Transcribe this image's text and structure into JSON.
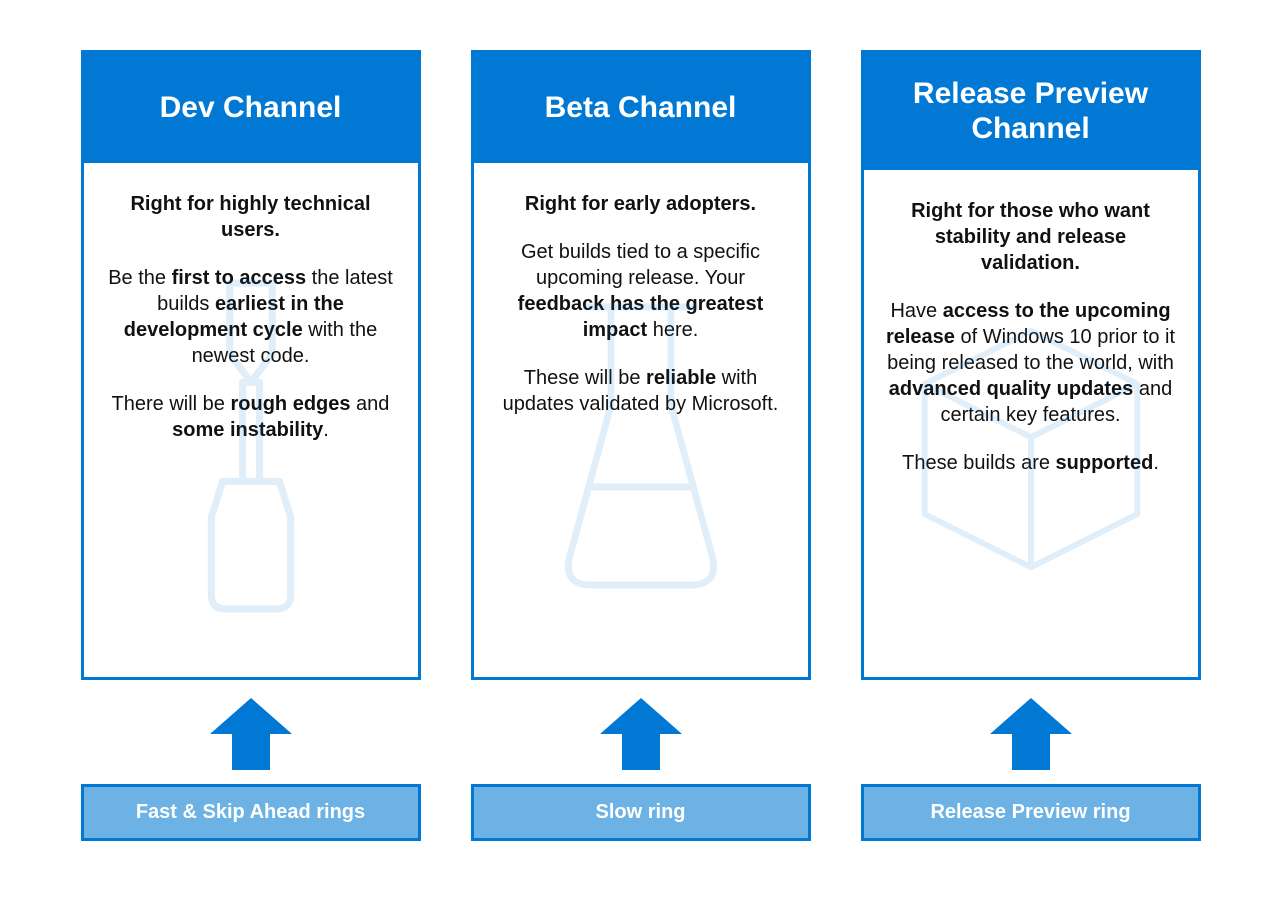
{
  "colors": {
    "brand": "#0078D4",
    "ringFill": "#6CB2E4"
  },
  "channels": [
    {
      "title": "Dev Channel",
      "lead": "Right for highly technical users.",
      "body_html": "Be the <b>first to access</b> the latest builds <b>earliest in the development cycle</b> with the newest code.",
      "tail_html": "There will be <b>rough edges</b> and <b>some instability</b>.",
      "ring": "Fast & Skip Ahead rings",
      "icon": "screwdriver"
    },
    {
      "title": "Beta Channel",
      "lead": "Right for early adopters.",
      "body_html": "Get builds tied to a specific upcoming release. Your <b>feedback has the greatest impact</b> here.",
      "tail_html": "These will be <b>reliable</b> with updates validated by Microsoft.",
      "ring": "Slow ring",
      "icon": "beaker"
    },
    {
      "title": "Release Preview Channel",
      "lead": "Right for those who want stability and release validation.",
      "body_html": "Have <b>access to the upcoming release</b> of Windows 10 prior to it being released to the world, with <b>advanced quality updates</b> and certain key features.",
      "tail_html": "These builds are <b>supported</b>.",
      "ring": "Release Preview ring",
      "icon": "package"
    }
  ]
}
